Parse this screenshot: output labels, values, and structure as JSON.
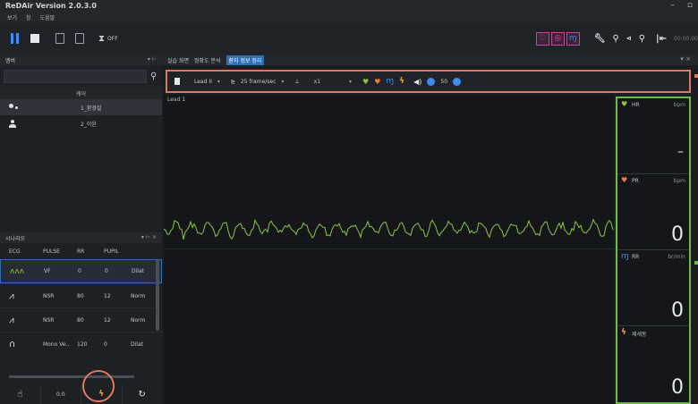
{
  "app": {
    "title": "ReDAir Version 2.0.3.0"
  },
  "menu": [
    "보기",
    "창",
    "도움말"
  ],
  "toolbar": {
    "off_label": "OFF",
    "time_display": "00:00:00"
  },
  "left_panel": {
    "header": "멤버",
    "list_header": "케어",
    "items": [
      {
        "name": "1_환경설",
        "icon": "group-icon",
        "selected": true
      },
      {
        "name": "2_이윤",
        "icon": "person-icon",
        "selected": false
      }
    ]
  },
  "scenario": {
    "header": "시나리오",
    "columns": [
      "ECG",
      "PULSE",
      "RR",
      "PUPIL"
    ],
    "rows": [
      {
        "ecg": "VF",
        "pulse": "0",
        "rr": "0",
        "pupil": "Dilat"
      },
      {
        "ecg": "NSR",
        "pulse": "80",
        "rr": "12",
        "pupil": "Norm"
      },
      {
        "ecg": "NSR",
        "pulse": "80",
        "rr": "12",
        "pupil": "Norm"
      },
      {
        "ecg": "Mono Ve..",
        "pulse": "120",
        "rr": "0",
        "pupil": "Dilat"
      }
    ],
    "bottom": [
      "",
      "0.0",
      "",
      ""
    ]
  },
  "tabs": [
    "실습 화면",
    "정확도 분석",
    "환자 정보 정리"
  ],
  "active_tab_index": 2,
  "ecg_toolbar": {
    "lead": "Lead II",
    "speed": "25 frame/sec",
    "scale": "x1",
    "volume": "50"
  },
  "ecg": {
    "lead_label": "Lead 1",
    "rhythm": "VF"
  },
  "vitals": [
    {
      "name": "HR",
      "unit": "bpm",
      "value": "–",
      "icon": "heart-icon",
      "color": "#8cc63f"
    },
    {
      "name": "PR",
      "unit": "bpm",
      "value": "0",
      "icon": "heart-icon",
      "color": "#f47b3a"
    },
    {
      "name": "RR",
      "unit": "br/min",
      "value": "0",
      "icon": "lungs-icon",
      "color": "#3d8df2"
    },
    {
      "name": "제세동",
      "unit": "",
      "value": "0",
      "icon": "bolt-icon",
      "color": "#f6a823"
    }
  ]
}
